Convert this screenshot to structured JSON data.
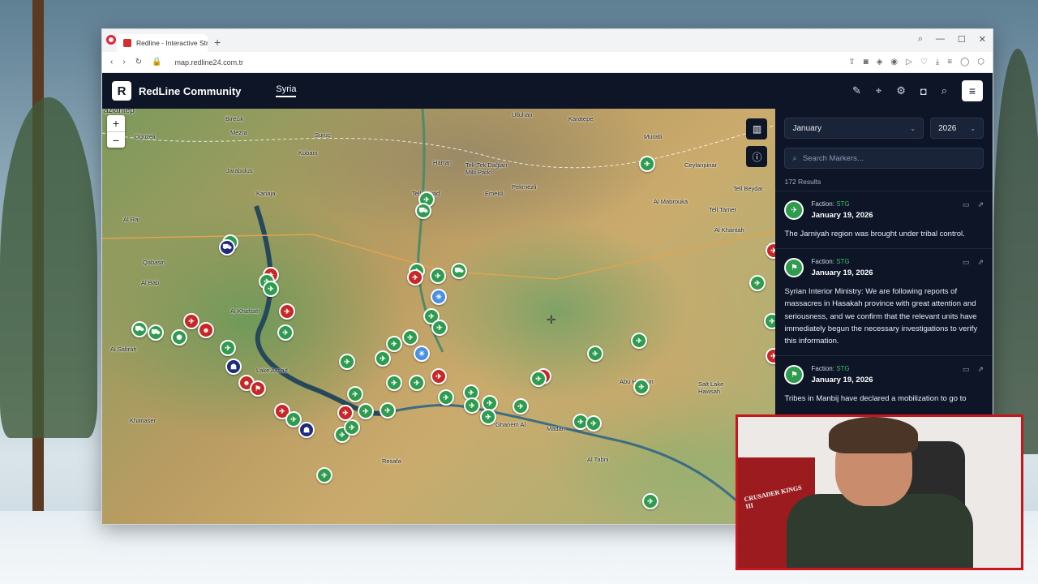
{
  "browser": {
    "tab_title": "Redline - Interactive Strate",
    "tab_close": "×",
    "new_tab": "+",
    "url": "map.redline24.com.tr"
  },
  "app": {
    "logo_letter": "R",
    "brand": "RedLine Community",
    "nav_item": "Syria"
  },
  "map": {
    "zoom_in": "+",
    "zoom_out": "−",
    "places": [
      "aziantep",
      "Oguzeli",
      "Birecik",
      "Mezra",
      "Suruç",
      "Harran",
      "Ulluhan",
      "Karatepe",
      "Muratli",
      "Ceylanpinar",
      "Kobani",
      "Jarabulus",
      "Kanaja",
      "Tell Abyad",
      "Tek Tek Dağları Milli Parkı",
      "Emekli",
      "Pekmezli",
      "Al Rai",
      "Qabasin",
      "Al Bab",
      "Al Khafsah",
      "Al Safirah",
      "Lake Assad",
      "Khanaser",
      "Resafa",
      "Ghanem Al",
      "Madan",
      "Al Tabni",
      "Abu Hamam",
      "Salt Lake Hawsah",
      "Al Mabrouka",
      "Tell Tamer",
      "Tell Beydar",
      "Al Khantah"
    ]
  },
  "sidebar": {
    "month": "January",
    "year": "2026",
    "search_placeholder": "Search Markers...",
    "results": "172 Results",
    "faction_label": "Faction:",
    "items": [
      {
        "faction": "STG",
        "date": "January 19, 2026",
        "text": "The Jarniyah region was brought under tribal control."
      },
      {
        "faction": "STG",
        "date": "January 19, 2026",
        "text": "Syrian Interior Ministry: We are following reports of massacres in Hasakah province with great attention and seriousness, and we confirm that the relevant units have immediately begun the necessary investigations to verify this information."
      },
      {
        "faction": "STG",
        "date": "January 19, 2026",
        "text": "Tribes in Manbij have declared a mobilization to go to"
      }
    ]
  },
  "webcam": {
    "poster_text": "CRUSADER KINGS III"
  },
  "colors": {
    "header_bg": "#0d1527",
    "faction_green": "#3fbf6a",
    "marker_green": "#2e9b4e",
    "marker_red": "#c62828",
    "marker_navy": "#1e2a7a",
    "webcam_border": "#c7161d"
  }
}
